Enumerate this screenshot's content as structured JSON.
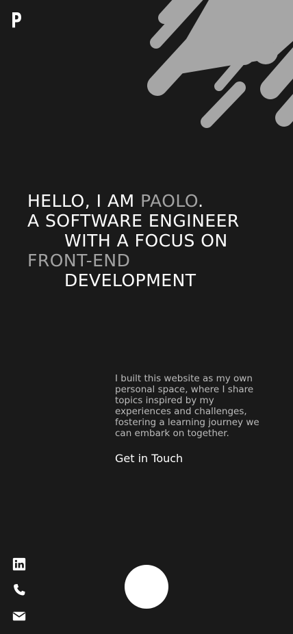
{
  "brand": {
    "logo_letter": "P"
  },
  "hero": {
    "greeting": "HELLO, I AM ",
    "name": "PAOLO",
    "period": ".",
    "line2": "A SOFTWARE ENGINEER",
    "line3": "WITH A FOCUS ON",
    "line4_accent": "FRONT-END",
    "line5": "DEVELOPMENT"
  },
  "about": {
    "text": "I built this website as my own personal space, where I share topics inspired by my experiences and challenges, fostering a learning journey we can embark on together."
  },
  "cta": {
    "label": "Get in Touch"
  },
  "social": {
    "linkedin_icon": "linkedin-icon",
    "phone_icon": "phone-icon",
    "email_icon": "mail-icon"
  },
  "colors": {
    "background": "#1a1a1a",
    "text": "#ffffff",
    "accent": "#a3a3a3",
    "muted_text": "#bdbdbd",
    "decor": "#a6a6a6"
  }
}
